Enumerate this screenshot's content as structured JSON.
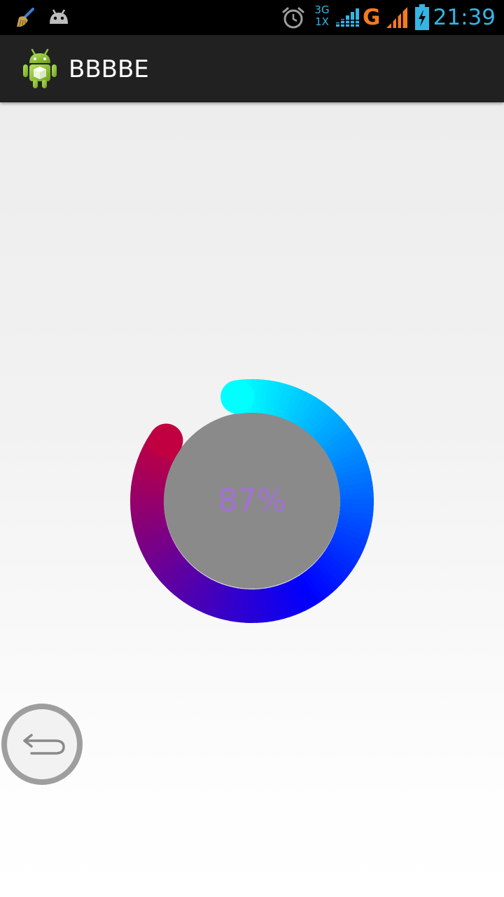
{
  "status_bar": {
    "time": "21:39",
    "network_type_top": "3G",
    "network_type_bottom": "1X",
    "data_letter": "G",
    "icons": [
      "cleaner-broom-icon",
      "android-debug-icon",
      "alarm-clock-icon",
      "signal-bars-icon",
      "mobile-signal-icon",
      "battery-charging-icon"
    ],
    "accent_color": "#33b5e5",
    "data_color": "#f47b20"
  },
  "action_bar": {
    "title": "BBBBE",
    "icon": "android-app-icon"
  },
  "progress": {
    "label": "87%",
    "value_percent": 87,
    "gradient_colors": [
      "#00ffff",
      "#0000ff",
      "#c00040"
    ],
    "center_color": "#8a8a8a",
    "label_color": "#a470d6"
  },
  "floating_button": {
    "icon": "back-arrow-icon"
  }
}
